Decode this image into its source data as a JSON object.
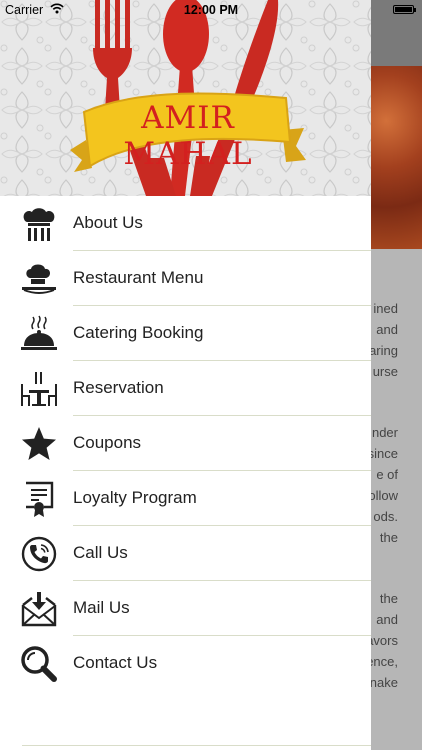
{
  "status_bar": {
    "carrier": "Carrier",
    "time": "12:00 PM"
  },
  "banner": {
    "logo_text": "AMIR MAHAL"
  },
  "menu": [
    {
      "label": "About Us",
      "icon": "chef-team-icon"
    },
    {
      "label": "Restaurant Menu",
      "icon": "chef-hat-icon"
    },
    {
      "label": "Catering Booking",
      "icon": "cloche-icon"
    },
    {
      "label": "Reservation",
      "icon": "dining-table-icon"
    },
    {
      "label": "Coupons",
      "icon": "star-icon"
    },
    {
      "label": "Loyalty Program",
      "icon": "certificate-icon"
    },
    {
      "label": "Call Us",
      "icon": "phone-icon"
    },
    {
      "label": "Mail Us",
      "icon": "mail-icon"
    },
    {
      "label": "Contact Us",
      "icon": "search-icon"
    }
  ],
  "background_page": {
    "text_lines_1": [
      "ined",
      "and",
      "aring",
      "urse"
    ],
    "text_lines_2": [
      "nder",
      "since",
      "e of",
      "ollow",
      "ods.",
      "the"
    ],
    "text_lines_3": [
      "the",
      "and",
      "avors",
      "ence,",
      "nake"
    ]
  },
  "colors": {
    "accent_red": "#d3201f",
    "banner_yellow": "#f3c51e",
    "divider": "#d9ddc9",
    "overlay_gray": "#b6b6b6"
  }
}
